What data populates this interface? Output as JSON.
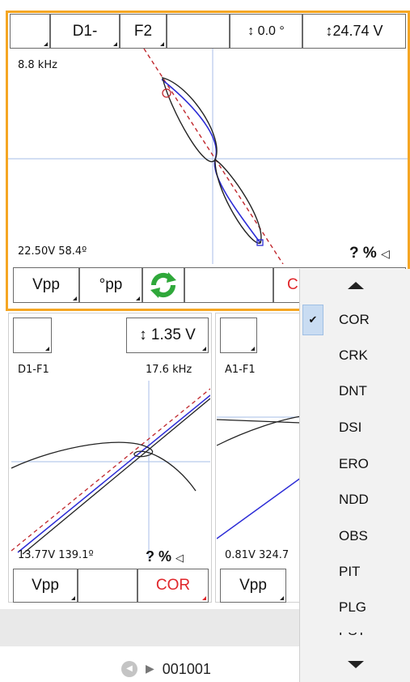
{
  "main_panel": {
    "toolbar": {
      "ch1": "D1-",
      "ch2": "F2",
      "rotation": "↕   0.0 °",
      "span": "↕24.74 V"
    },
    "freq": "8.8 kHz",
    "reading": "22.50V 58.4º",
    "status": "? %",
    "bottom": {
      "vpp": "Vpp",
      "phase": "°pp",
      "cor_partial": "C"
    }
  },
  "panel_left": {
    "span": "↕ 1.35 V",
    "name": "D1-F1",
    "freq": "17.6 kHz",
    "reading": "13.77V 139.1º",
    "status": "? %",
    "bottom": {
      "vpp": "Vpp",
      "cor": "COR"
    }
  },
  "panel_mid": {
    "name": "A1-F1",
    "reading": "0.81V 324.7",
    "bottom": {
      "vpp": "Vpp"
    }
  },
  "dropdown": {
    "selected": "COR",
    "items": [
      "COR",
      "CRK",
      "DNT",
      "DSI",
      "ERO",
      "NDD",
      "OBS",
      "PIT",
      "PLG"
    ],
    "partial_item": "PST"
  },
  "footer": {
    "record": "001001"
  },
  "colors": {
    "active_border": "#f5a623",
    "trace_blue": "#2b2bd6",
    "ref_red": "#c0272d",
    "refresh_green": "#2fa83a",
    "selection": "#c9dcf2"
  }
}
